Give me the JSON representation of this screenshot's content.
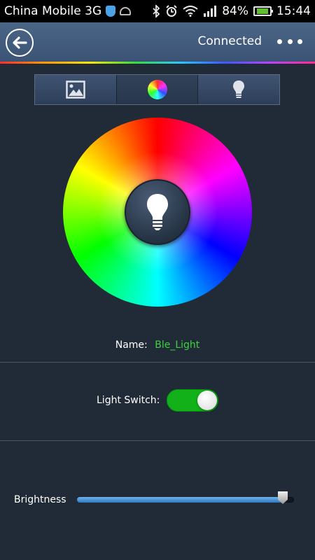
{
  "statusbar": {
    "carrier": "China Mobile 3G",
    "battery_percent": "84%",
    "time": "15:44",
    "battery_level": 0.84,
    "icons": [
      "shield-icon",
      "android-icon",
      "bluetooth-icon",
      "alarm-icon",
      "wifi-icon",
      "signal-icon",
      "battery-icon"
    ]
  },
  "appbar": {
    "status": "Connected",
    "back_icon": "back-arrow-icon",
    "menu_icon": "more-icon"
  },
  "tabs": [
    {
      "icon": "image-icon",
      "active": false
    },
    {
      "icon": "color-wheel-icon",
      "active": true
    },
    {
      "icon": "bulb-icon",
      "active": false
    }
  ],
  "device": {
    "name_label": "Name:",
    "name_value": "Ble_Light"
  },
  "light_switch": {
    "label": "Light Switch:",
    "on": true
  },
  "brightness": {
    "label": "Brightness",
    "value": 0.97
  },
  "colors": {
    "background": "#212b38",
    "appbar": "#4b6587",
    "accent_green": "#3cd23c",
    "toggle_on": "#12b11a",
    "slider_fill": "#3f8fd8"
  }
}
